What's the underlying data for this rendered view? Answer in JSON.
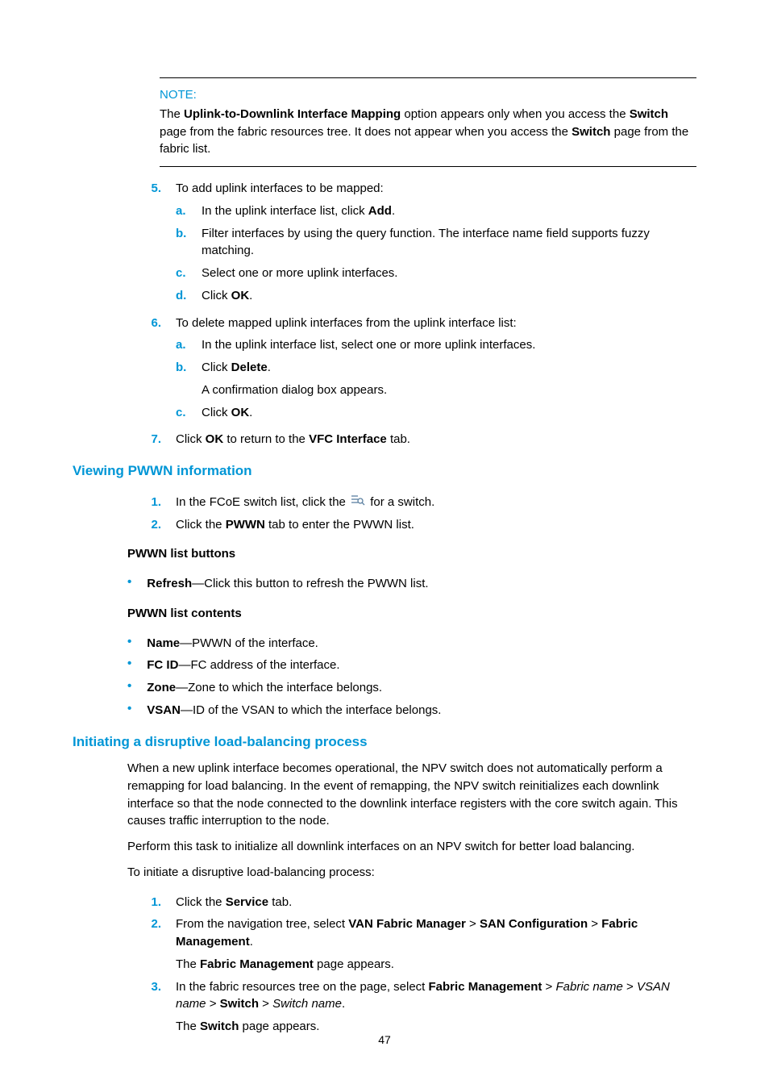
{
  "note": {
    "label": "NOTE:",
    "body_parts": [
      "The ",
      "Uplink-to-Downlink Interface Mapping",
      " option appears only when you access the ",
      "Switch",
      " page from the fabric resources tree. It does not appear when you access the ",
      "Switch",
      " page from the fabric list."
    ]
  },
  "step5": {
    "num": "5.",
    "text": "To add uplink interfaces to be mapped:",
    "subs": {
      "a": {
        "letter": "a.",
        "parts": [
          "In the uplink interface list, click ",
          "Add",
          "."
        ]
      },
      "b": {
        "letter": "b.",
        "text": "Filter interfaces by using the query function. The interface name field supports fuzzy matching."
      },
      "c": {
        "letter": "c.",
        "text": "Select one or more uplink interfaces."
      },
      "d": {
        "letter": "d.",
        "parts": [
          "Click ",
          "OK",
          "."
        ]
      }
    }
  },
  "step6": {
    "num": "6.",
    "text": "To delete mapped uplink interfaces from the uplink interface list:",
    "subs": {
      "a": {
        "letter": "a.",
        "text": "In the uplink interface list, select one or more uplink interfaces."
      },
      "b": {
        "letter": "b.",
        "parts": [
          "Click ",
          "Delete",
          "."
        ],
        "extra": "A confirmation dialog box appears."
      },
      "c": {
        "letter": "c.",
        "parts": [
          "Click ",
          "OK",
          "."
        ]
      }
    }
  },
  "step7": {
    "num": "7.",
    "parts": [
      "Click ",
      "OK",
      " to return to the ",
      "VFC Interface",
      " tab."
    ]
  },
  "heading_pwwn": "Viewing PWWN information",
  "pwwn_step1": {
    "num": "1.",
    "pre": "In the FCoE switch list, click the ",
    "post": " for a switch."
  },
  "pwwn_step2": {
    "num": "2.",
    "parts": [
      "Click the ",
      "PWWN",
      " tab to enter the PWWN list."
    ]
  },
  "pwwn_buttons_header": "PWWN list buttons",
  "pwwn_buttons": {
    "refresh": {
      "term": "Refresh",
      "desc": "—Click this button to refresh the PWWN list."
    }
  },
  "pwwn_contents_header": "PWWN list contents",
  "pwwn_contents": {
    "name": {
      "term": "Name",
      "desc": "—PWWN of the interface."
    },
    "fcid": {
      "term": "FC ID",
      "desc": "—FC address of the interface."
    },
    "zone": {
      "term": "Zone",
      "desc": "—Zone to which the interface belongs."
    },
    "vsan": {
      "term": "VSAN",
      "desc": "—ID of the VSAN to which the interface belongs."
    }
  },
  "heading_load": "Initiating a disruptive load-balancing process",
  "load_p1": "When a new uplink interface becomes operational, the NPV switch does not automatically perform a remapping for load balancing. In the event of remapping, the NPV switch reinitializes each downlink interface so that the node connected to the downlink interface registers with the core switch again. This causes traffic interruption to the node.",
  "load_p2": "Perform this task to initialize all downlink interfaces on an NPV switch for better load balancing.",
  "load_p3": "To initiate a disruptive load-balancing process:",
  "load_step1": {
    "num": "1.",
    "parts": [
      "Click the ",
      "Service",
      " tab."
    ]
  },
  "load_step2": {
    "num": "2.",
    "parts": [
      "From the navigation tree, select ",
      "VAN Fabric Manager",
      " > ",
      "SAN Configuration",
      " > ",
      "Fabric Management",
      "."
    ],
    "extra_parts": [
      "The ",
      "Fabric Management",
      " page appears."
    ]
  },
  "load_step3": {
    "num": "3.",
    "parts": [
      "In the fabric resources tree on the page, select ",
      "Fabric Management",
      " > ",
      "Fabric name",
      " > ",
      "VSAN name",
      " > ",
      "Switch",
      " > ",
      "Switch name",
      "."
    ],
    "extra_parts": [
      "The ",
      "Switch",
      " page appears."
    ]
  },
  "page_number": "47"
}
